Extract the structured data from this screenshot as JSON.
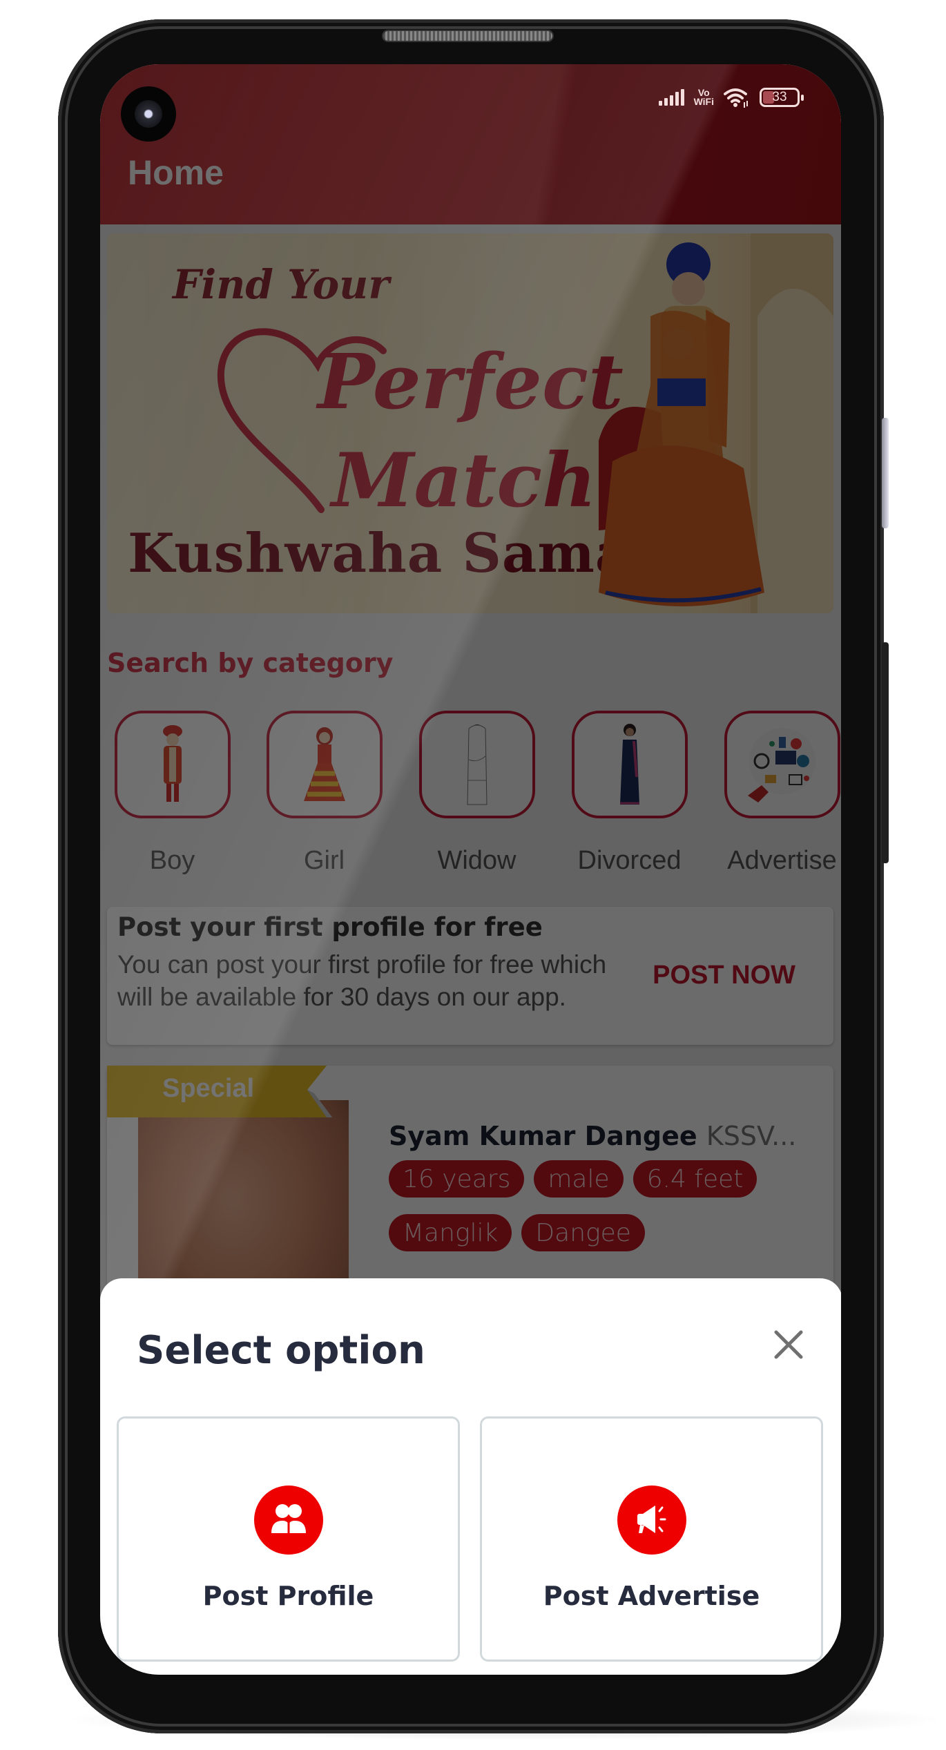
{
  "status_bar": {
    "network": "signal-icon",
    "vowifi_top": "Vo",
    "vowifi_bottom": "WiFi",
    "wifi": "wifi-icon",
    "battery_level": "33"
  },
  "app_bar": {
    "title": "Home"
  },
  "banner": {
    "line1": "Find Your",
    "line2": "Perfect",
    "line3": "Match",
    "line4": "Kushwaha Samaj"
  },
  "category_section": {
    "title": "Search by category",
    "items": [
      {
        "label": "Boy",
        "icon": "groom-illustration"
      },
      {
        "label": "Girl",
        "icon": "bride-illustration"
      },
      {
        "label": "Widow",
        "icon": "widow-illustration"
      },
      {
        "label": "Divorced",
        "icon": "divorced-illustration"
      },
      {
        "label": "Advertise",
        "icon": "advertise-illustration"
      }
    ]
  },
  "post_card": {
    "title": "Post your first profile for free",
    "description": "You can post your first profile for free which will be available for 30 days on our app.",
    "button": "POST NOW"
  },
  "profile_card": {
    "badge": "Special",
    "name": "Syam Kumar Dangee",
    "id": "KSSV...",
    "tags": [
      "16 years",
      "male",
      "6.4 feet",
      "Manglik",
      "Dangee"
    ]
  },
  "sheet": {
    "title": "Select option",
    "options": [
      {
        "label": "Post Profile",
        "icon": "users-icon"
      },
      {
        "label": "Post Advertise",
        "icon": "megaphone-icon"
      }
    ]
  },
  "colors": {
    "primary": "#c8283c",
    "tag_bg": "#c31825",
    "option_icon_bg": "#ee0000",
    "ribbon": "#e9bf2a"
  }
}
